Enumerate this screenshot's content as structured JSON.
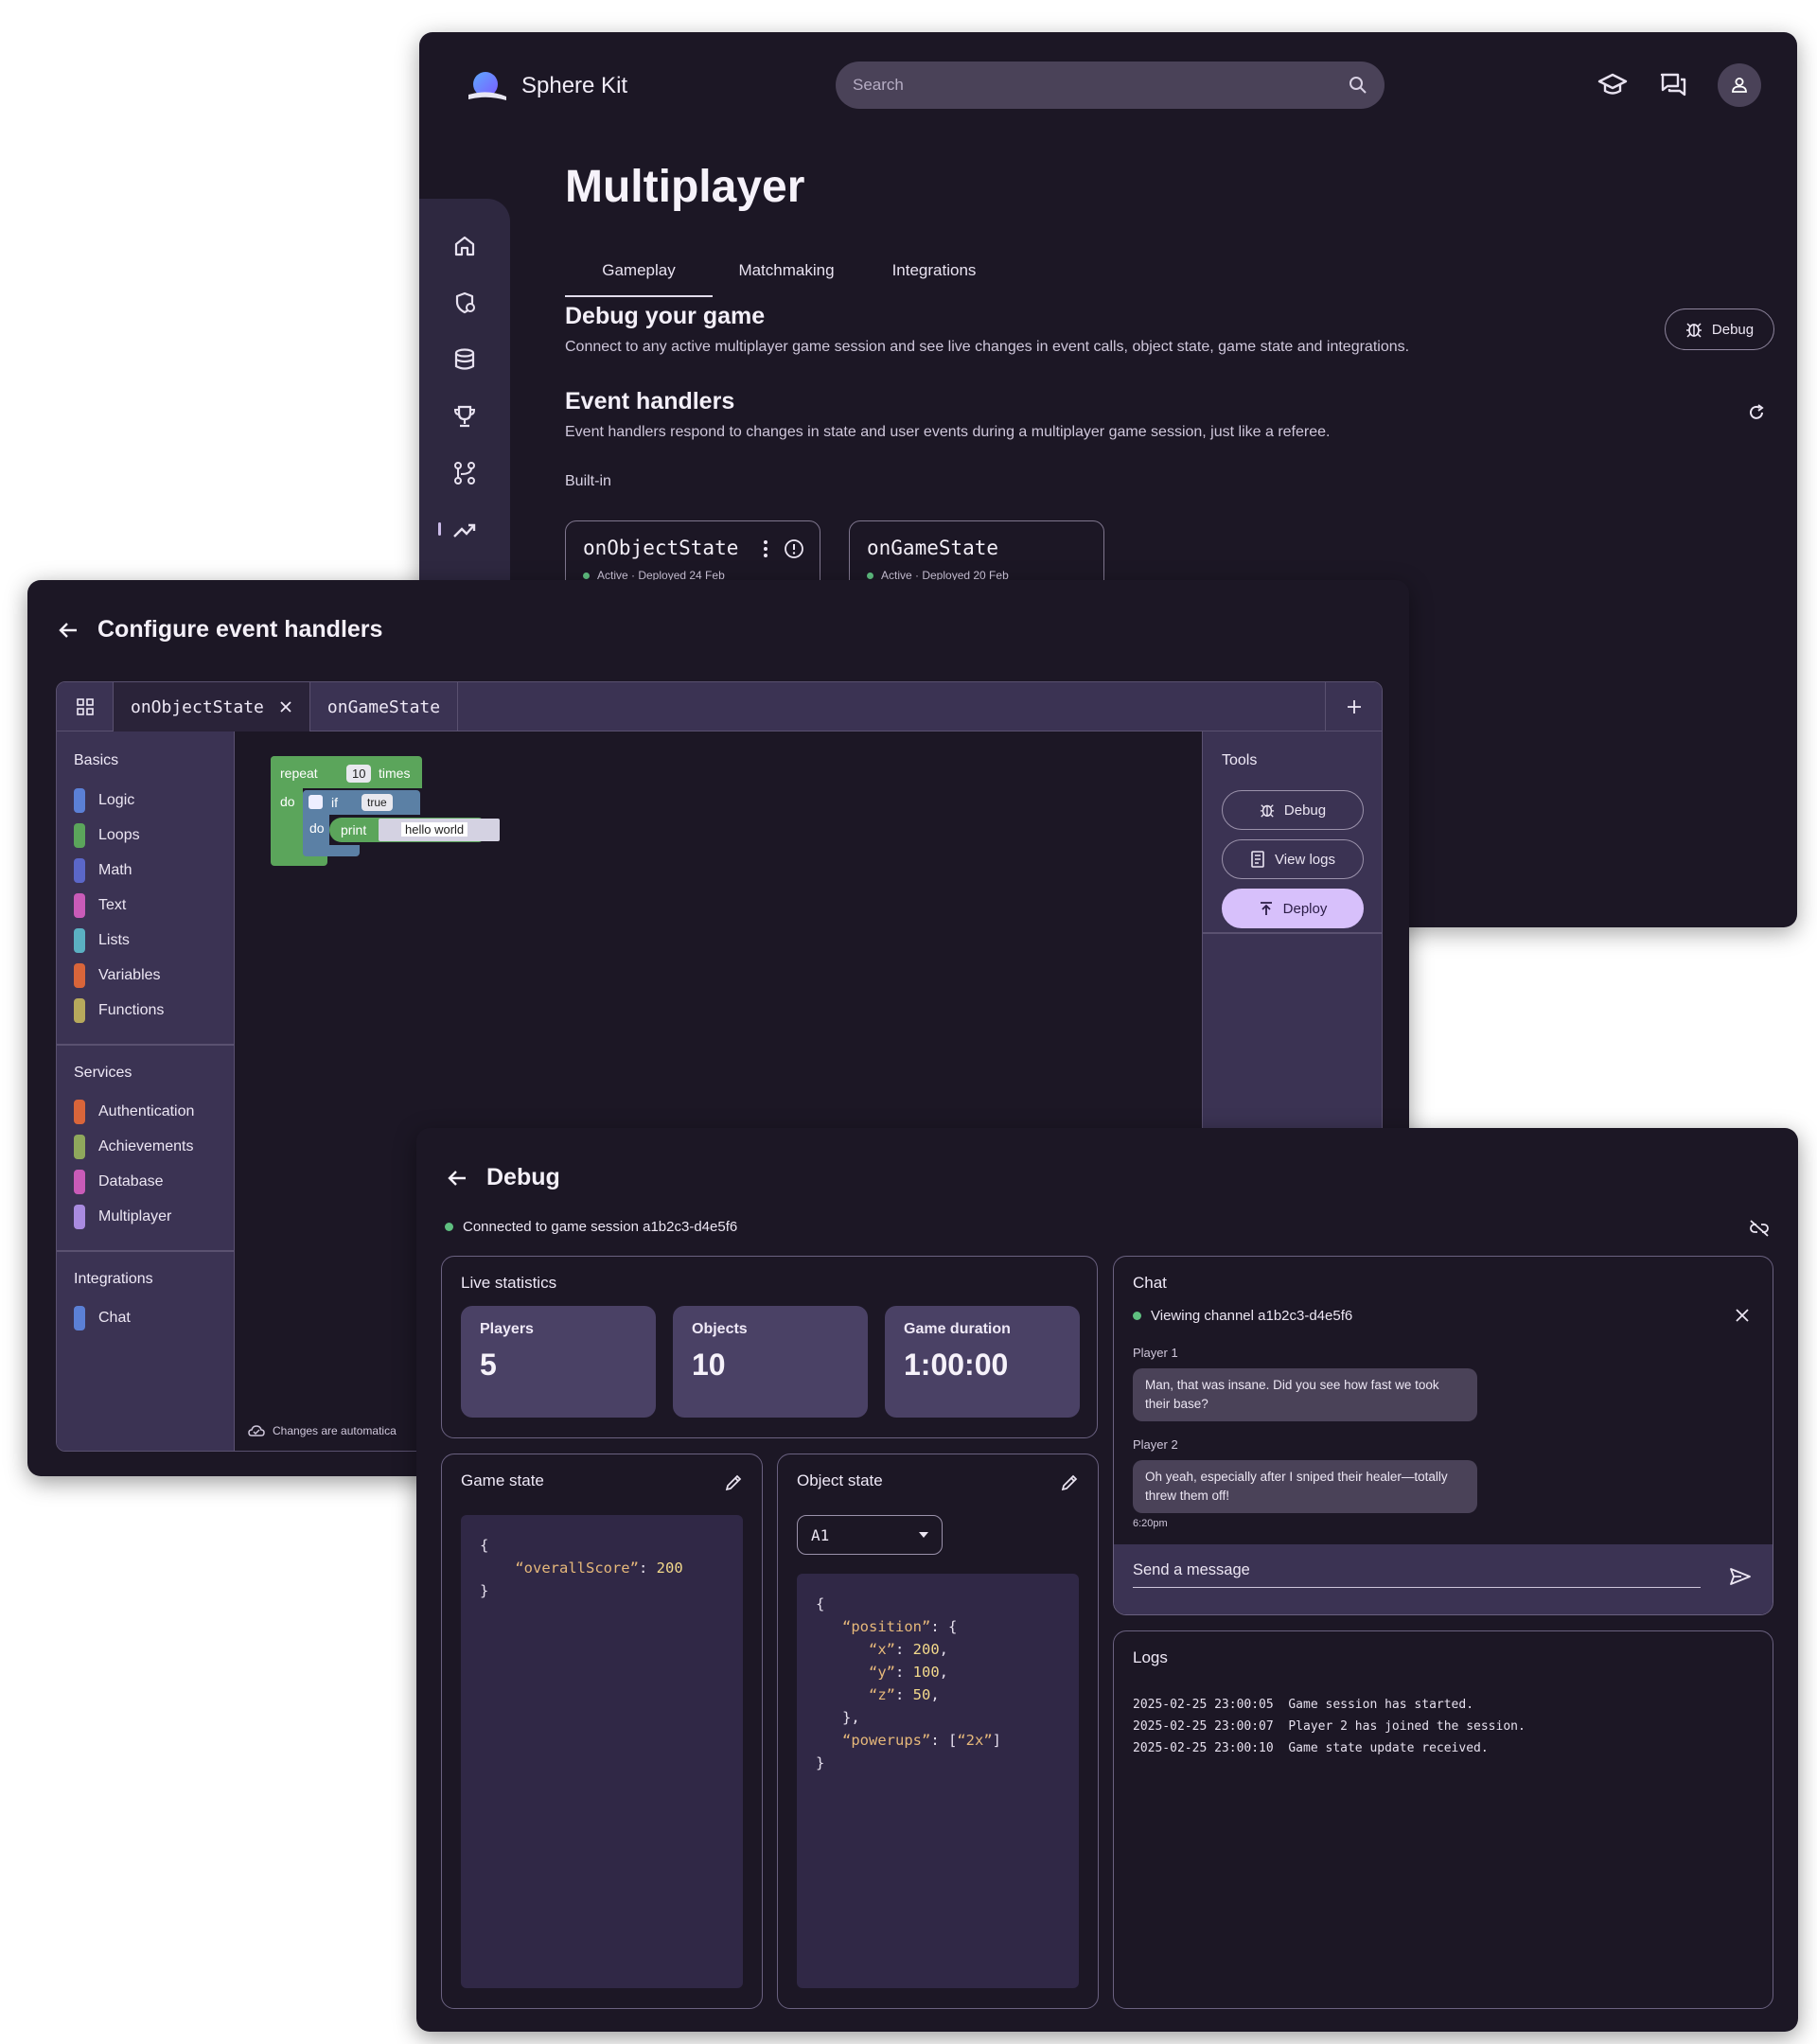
{
  "app": {
    "name": "Sphere Kit"
  },
  "header": {
    "search_placeholder": "Search"
  },
  "colors": {
    "accent": "#d7c0fb",
    "background": "#1c1725",
    "surface": "#3b3353",
    "status_active": "#5fbf80"
  },
  "dashboard": {
    "title": "Multiplayer",
    "tabs": [
      "Gameplay",
      "Matchmaking",
      "Integrations"
    ],
    "active_tab": "Gameplay",
    "debug_section": {
      "heading": "Debug your game",
      "description": "Connect to any active multiplayer game session and see live changes in event calls, object state, game state and integrations.",
      "button": "Debug"
    },
    "handlers_section": {
      "heading": "Event handlers",
      "description": "Event handlers respond to changes in state and user events during a multiplayer game session, just like a referee.",
      "builtin_label": "Built-in",
      "cards": [
        {
          "name": "onObjectState",
          "status": "Active · Deployed 24 Feb"
        },
        {
          "name": "onGameState",
          "status": "Active · Deployed 20 Feb"
        }
      ]
    },
    "rail_icons": [
      "home-icon",
      "shield-icon",
      "database-icon",
      "trophy-icon",
      "flow-icon",
      "trending-icon"
    ]
  },
  "configure": {
    "title": "Configure event handlers",
    "tabs": [
      "onObjectState",
      "onGameState"
    ],
    "palette": {
      "basics_label": "Basics",
      "basics": [
        {
          "label": "Logic",
          "color": "#5b80d6"
        },
        {
          "label": "Loops",
          "color": "#5ba55b"
        },
        {
          "label": "Math",
          "color": "#5b67c8"
        },
        {
          "label": "Text",
          "color": "#c95bb8"
        },
        {
          "label": "Lists",
          "color": "#5bb0c2"
        },
        {
          "label": "Variables",
          "color": "#d9653a"
        },
        {
          "label": "Functions",
          "color": "#b7a95c"
        }
      ],
      "services_label": "Services",
      "services": [
        {
          "label": "Authentication",
          "color": "#d9653a"
        },
        {
          "label": "Achievements",
          "color": "#8fa85c"
        },
        {
          "label": "Database",
          "color": "#c95bb8"
        },
        {
          "label": "Multiplayer",
          "color": "#a98be0"
        }
      ],
      "integrations_label": "Integrations",
      "integrations": [
        {
          "label": "Chat",
          "color": "#5b80d6"
        }
      ]
    },
    "blocks": {
      "repeat": "repeat",
      "count": "10",
      "times": "times",
      "do": "do",
      "if": "if",
      "cond": "true",
      "do2": "do",
      "print": "print",
      "text": "hello world"
    },
    "tools": {
      "title": "Tools",
      "debug": "Debug",
      "view_logs": "View logs",
      "deploy": "Deploy"
    },
    "autosave": "Changes are automatica"
  },
  "debug": {
    "title": "Debug",
    "connection": "Connected to game session a1b2c3-d4e5f6",
    "live_stats": {
      "title": "Live statistics",
      "stats": [
        {
          "label": "Players",
          "value": "5"
        },
        {
          "label": "Objects",
          "value": "10"
        },
        {
          "label": "Game duration",
          "value": "1:00:00"
        }
      ]
    },
    "game_state": {
      "title": "Game state",
      "key": "“overallScore”",
      "value": "200"
    },
    "object_state": {
      "title": "Object state",
      "selected": "A1",
      "position_key": "“position”",
      "x_key": "“x”",
      "x": "200",
      "y_key": "“y”",
      "y": "100",
      "z_key": "“z”",
      "z": "50",
      "powerups_key": "“powerups”",
      "powerups_value": "“2x”"
    },
    "chat": {
      "title": "Chat",
      "channel": "Viewing channel a1b2c3-d4e5f6",
      "messages": [
        {
          "author": "Player 1",
          "text": "Man, that was insane. Did you see how fast we took their base?"
        },
        {
          "author": "Player 2",
          "text": "Oh yeah, especially after I sniped their healer—totally threw them off!",
          "time": "6:20pm"
        }
      ],
      "input_placeholder": "Send a message"
    },
    "logs": {
      "title": "Logs",
      "entries": [
        "2025-02-25 23:00:05  Game session has started.",
        "2025-02-25 23:00:07  Player 2 has joined the session.",
        "2025-02-25 23:00:10  Game state update received."
      ]
    }
  }
}
